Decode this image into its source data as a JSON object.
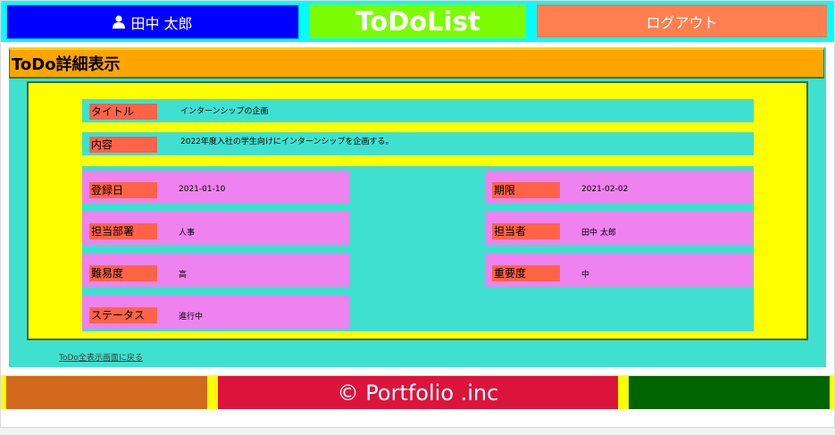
{
  "header": {
    "user_name": "田中 太郎",
    "app_title": "ToDoList",
    "logout_label": "ログアウト"
  },
  "main": {
    "page_title": "ToDo詳細表示",
    "title_label": "タイトル",
    "title_value": "インターンシップの企画",
    "content_label": "内容",
    "content_value": "2022年度入社の学生向けにインターンシップを企画する。",
    "fields": {
      "registered_label": "登録日",
      "registered_value": "2021-01-10",
      "deadline_label": "期限",
      "deadline_value": "2021-02-02",
      "department_label": "担当部署",
      "department_value": "人事",
      "assignee_label": "担当者",
      "assignee_value": "田中 太郎",
      "difficulty_label": "難易度",
      "difficulty_value": "高",
      "importance_label": "重要度",
      "importance_value": "中",
      "status_label": "ステータス",
      "status_value": "進行中"
    },
    "back_link": "ToDo全表示画面に戻る"
  },
  "footer": {
    "copyright": "© Portfolio .inc"
  },
  "icons": {
    "user": "user-icon"
  },
  "colors": {
    "header_bg": "#00ffff",
    "user_button": "#0000ff",
    "title_bg": "#7cfc00",
    "logout_button": "#ff7f50",
    "main_bg": "#40e0d0",
    "section_title_bg": "#ffa500",
    "detail_bg": "#ffff00",
    "label_bg": "#ff6347",
    "cell_bg": "#ee82ee",
    "footer_left": "#d2691e",
    "footer_mid": "#dc143c",
    "footer_right": "#006400"
  }
}
